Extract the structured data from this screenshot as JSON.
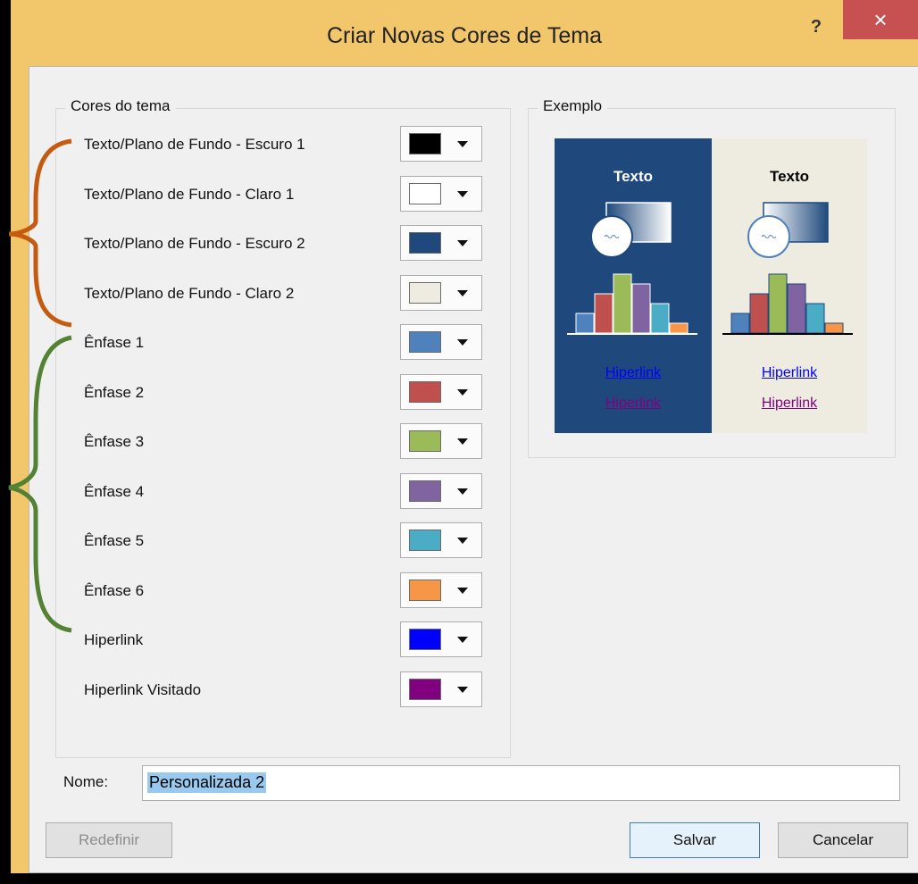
{
  "dialog": {
    "title": "Criar Novas Cores de Tema",
    "help": "?",
    "close": "×"
  },
  "theme_colors": {
    "group_label": "Cores do tema",
    "rows": [
      {
        "label": "Texto/Plano de Fundo - Escuro 1",
        "color": "#000000"
      },
      {
        "label": "Texto/Plano de Fundo - Claro 1",
        "color": "#ffffff"
      },
      {
        "label": "Texto/Plano de Fundo - Escuro 2",
        "color": "#1f497d"
      },
      {
        "label": "Texto/Plano de Fundo - Claro 2",
        "color": "#eeece1"
      },
      {
        "label": "Ênfase 1",
        "color": "#4f81bd"
      },
      {
        "label": "Ênfase 2",
        "color": "#c0504d"
      },
      {
        "label": "Ênfase 3",
        "color": "#9bbb59"
      },
      {
        "label": "Ênfase 4",
        "color": "#8064a2"
      },
      {
        "label": "Ênfase 5",
        "color": "#4bacc6"
      },
      {
        "label": "Ênfase 6",
        "color": "#f79646"
      },
      {
        "label": "Hiperlink",
        "color": "#0000ff"
      },
      {
        "label": "Hiperlink Visitado",
        "color": "#800080"
      }
    ]
  },
  "example": {
    "group_label": "Exemplo",
    "text": "Texto",
    "hyperlink": "Hiperlink",
    "visited_hyperlink": "Hiperlink",
    "bar_values": [
      2,
      4,
      6,
      5,
      3,
      1
    ]
  },
  "name": {
    "label": "Nome:",
    "value": "Personalizada 2"
  },
  "buttons": {
    "reset": "Redefinir",
    "save": "Salvar",
    "cancel": "Cancelar"
  },
  "colors": {
    "brace_text_background": "#c55a11",
    "brace_accents": "#548235",
    "window_frame": "#f2c66b"
  }
}
